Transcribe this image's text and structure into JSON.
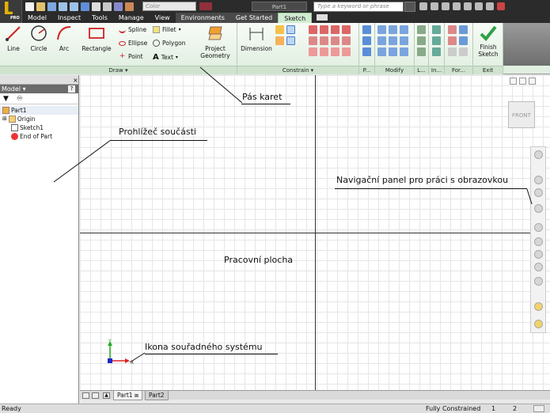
{
  "titlebar": {
    "color_dropdown": "Color",
    "doc_title": "Part1",
    "search_placeholder": "Type a keyword or phrase",
    "app_badge": "PRO"
  },
  "tabs": [
    {
      "label": "Model"
    },
    {
      "label": "Inspect"
    },
    {
      "label": "Tools"
    },
    {
      "label": "Manage"
    },
    {
      "label": "View"
    },
    {
      "label": "Environments"
    },
    {
      "label": "Get Started"
    },
    {
      "label": "Sketch",
      "active": true
    }
  ],
  "ribbon": {
    "draw": {
      "title": "Draw",
      "line": "Line",
      "circle": "Circle",
      "arc": "Arc",
      "rectangle": "Rectangle",
      "spline": "Spline",
      "ellipse": "Ellipse",
      "point": "Point",
      "fillet": "Fillet",
      "polygon": "Polygon",
      "text": "Text",
      "project_geometry_1": "Project",
      "project_geometry_2": "Geometry"
    },
    "constrain": {
      "title": "Constrain",
      "dimension": "Dimension"
    },
    "pattern": {
      "title": "P..."
    },
    "modify": {
      "title": "Modify"
    },
    "layout": {
      "title": "L..."
    },
    "insert": {
      "title": "In..."
    },
    "format": {
      "title": "For..."
    },
    "exit": {
      "title": "Exit",
      "finish_1": "Finish",
      "finish_2": "Sketch"
    }
  },
  "browser": {
    "title": "Model",
    "help": "?",
    "items": [
      {
        "label": "Part1"
      },
      {
        "label": "Origin"
      },
      {
        "label": "Sketch1"
      },
      {
        "label": "End of Part"
      }
    ]
  },
  "viewcube": {
    "label": "FRONT"
  },
  "annotations": {
    "ribbon": "Pás karet",
    "browser": "Prohlížeč součásti",
    "navbar": "Navigační panel pro práci s obrazovkou",
    "workspace": "Pracovní plocha",
    "coord": "Ikona souřadného systému"
  },
  "triad": {
    "x": "X",
    "y": "Y"
  },
  "doc_tabs": [
    {
      "label": "Part1"
    },
    {
      "label": "Part2"
    }
  ],
  "status": {
    "left": "Ready",
    "constraint": "Fully Constrained",
    "n1": "1",
    "n2": "2"
  },
  "colors": {
    "ribbon_accent": "#d2ebd2",
    "finish_green": "#2ea043",
    "dark_chrome": "#2b2b2b"
  }
}
